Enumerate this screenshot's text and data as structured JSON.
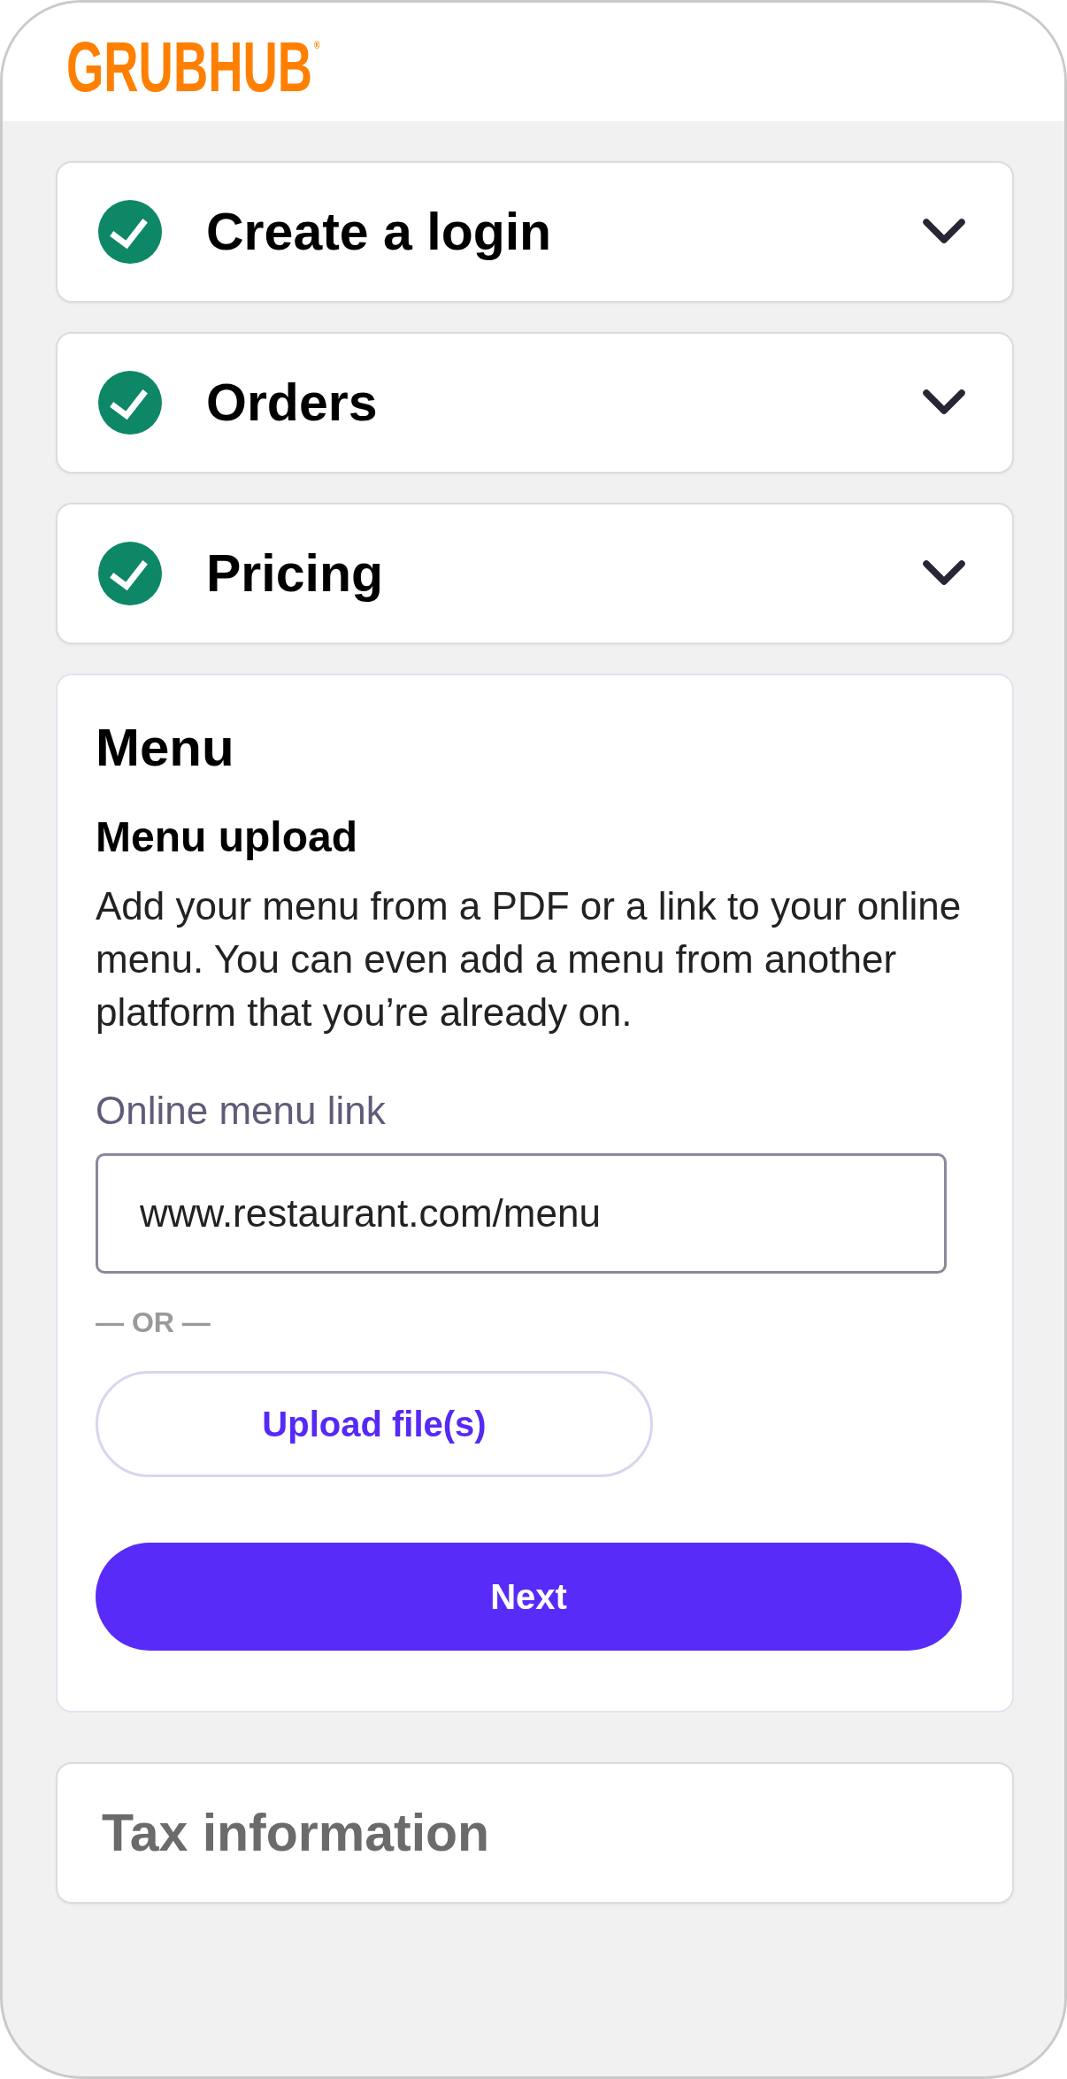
{
  "header": {
    "logo": "GRUBHUB$^{®}$"
  },
  "steps": [
    {
      "title": "Create a login",
      "completed": true,
      "expanded": false
    },
    {
      "title": "Orders",
      "completed": true,
      "expanded": false
    },
    {
      "title": "Pricing",
      "completed": true,
      "expanded": false
    },
    {
      "title": "Menu",
      "completed": false,
      "expanded": true,
      "section": {
        "heading": "Menu upload",
        "description": "Add your menu from a PDF or a link to your online menu. You can even add a menu from another platform that you’re already on.",
        "link_field": {
          "label": "Online menu link",
          "value": "www.restaurant.com/menu"
        },
        "divider": "— OR —",
        "upload_button": "Upload file(s)",
        "next_button": "Next"
      }
    },
    {
      "title": "Tax information",
      "completed": false,
      "expanded": false
    }
  ]
}
